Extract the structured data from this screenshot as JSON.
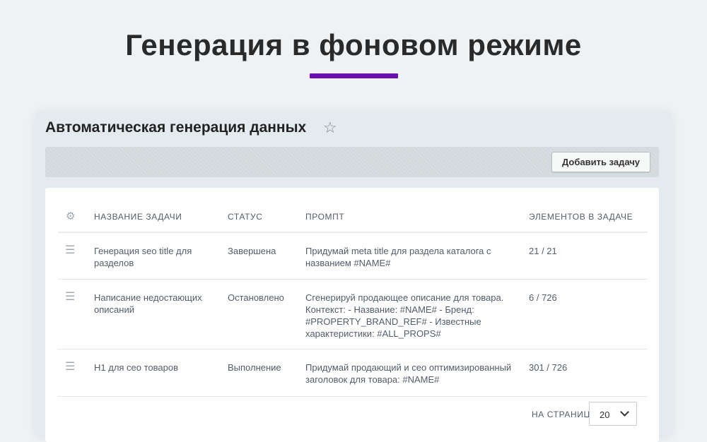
{
  "hero": {
    "title": "Генерация в фоновом режиме",
    "accent_color": "#6a0dad"
  },
  "panel": {
    "title": "Автоматическая генерация данных",
    "star_icon": "star-icon",
    "add_task_label": "Добавить задачу"
  },
  "table": {
    "settings_icon": "gear-icon",
    "headers": {
      "name": "НАЗВАНИЕ ЗАДАЧИ",
      "status": "СТАТУС",
      "prompt": "ПРОМПТ",
      "count": "ЭЛЕМЕНТОВ В ЗАДАЧЕ"
    },
    "rows": [
      {
        "name": "Генерация seo title для разделов",
        "status": "Завершена",
        "prompt": "Придумай meta title для раздела каталога с названием #NAME#",
        "count": "21 / 21"
      },
      {
        "name": "Написание недостающих описаний",
        "status": "Остановлено",
        "prompt": "Сгенерируй продающее описание для товара. Контекст: - Название: #NAME# - Бренд: #PROPERTY_BRAND_REF# - Известные характеристики: #ALL_PROPS#",
        "count": "6 / 726"
      },
      {
        "name": "H1 для сео товаров",
        "status": "Выполнение",
        "prompt": "Придумай продающий и сео оптимизированный заголовок для товара: #NAME#",
        "count": "301 / 726"
      }
    ]
  },
  "pagination": {
    "per_page_label": "НА СТРАНИЦЕ:",
    "per_page_value": "20"
  }
}
